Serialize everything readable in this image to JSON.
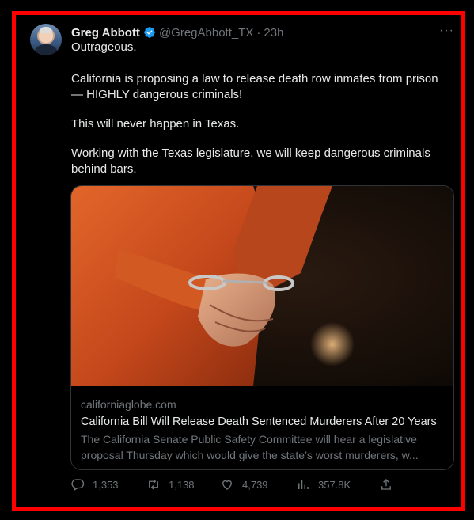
{
  "tweet": {
    "author_name": "Greg Abbott",
    "handle": "@GregAbbott_TX",
    "separator": "·",
    "time": "23h",
    "more": "···",
    "paragraphs": [
      "Outrageous.",
      "California is proposing a law to release death row inmates from prison — HIGHLY dangerous criminals!",
      "This will never happen in Texas.",
      "Working with the Texas legislature, we will keep dangerous criminals behind bars."
    ]
  },
  "card": {
    "domain": "californiaglobe.com",
    "title": "California Bill Will Release Death Sentenced Murderers After 20 Years",
    "description": "The California Senate Public Safety Committee will hear a legislative proposal Thursday which would give the state’s worst murderers, w..."
  },
  "actions": {
    "replies": "1,353",
    "reposts": "1,138",
    "likes": "4,739",
    "views": "357.8K"
  },
  "colors": {
    "frame": "#ff0000",
    "text": "#e7e9ea",
    "muted": "#71767b",
    "verified": "#1d9bf0"
  },
  "icons": [
    "reply-icon",
    "repost-icon",
    "like-icon",
    "views-icon",
    "share-icon",
    "verified-badge-icon",
    "more-icon"
  ]
}
